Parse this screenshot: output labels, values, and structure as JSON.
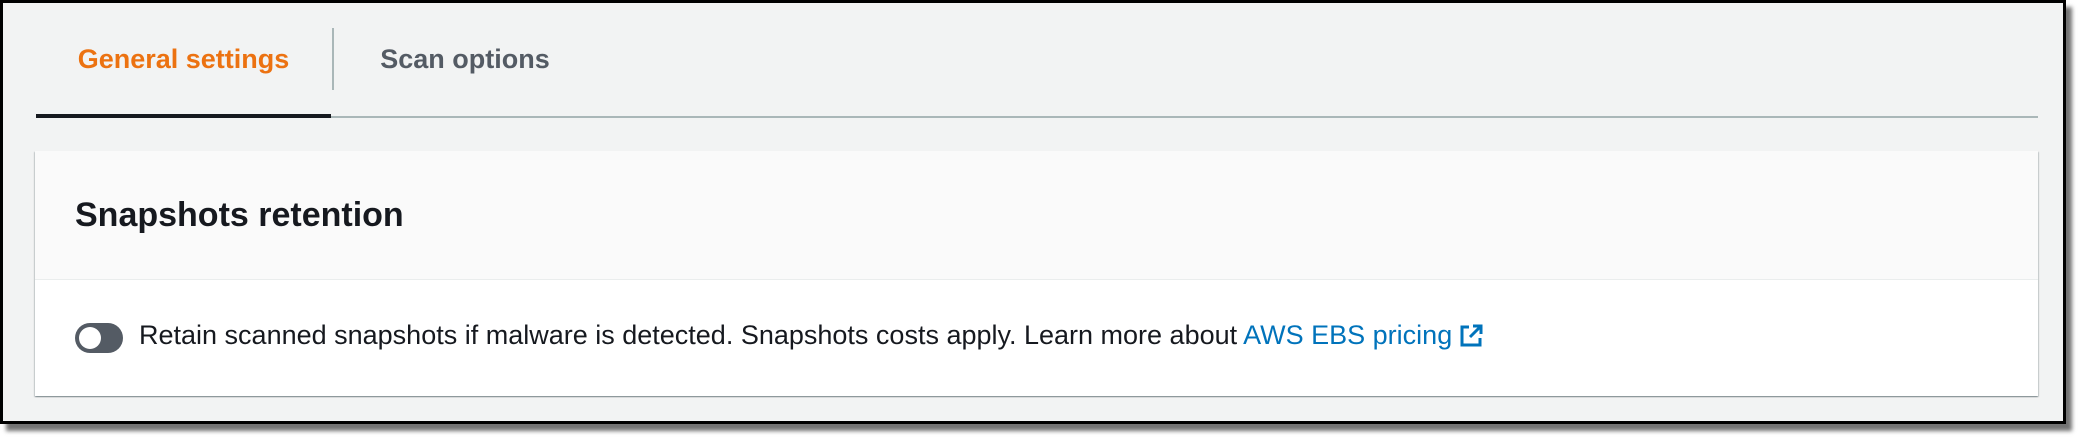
{
  "tabs": [
    {
      "label": "General settings",
      "active": true
    },
    {
      "label": "Scan options",
      "active": false
    }
  ],
  "panel": {
    "title": "Snapshots retention",
    "toggle_on": false,
    "description": "Retain scanned snapshots if malware is detected. Snapshots costs apply. Learn more about ",
    "link_label": "AWS EBS pricing",
    "link_icon": "external-link-icon"
  },
  "colors": {
    "active_tab": "#ec7211",
    "inactive_tab": "#545b64",
    "link": "#0073bb",
    "toggle_off": "#545b64"
  }
}
